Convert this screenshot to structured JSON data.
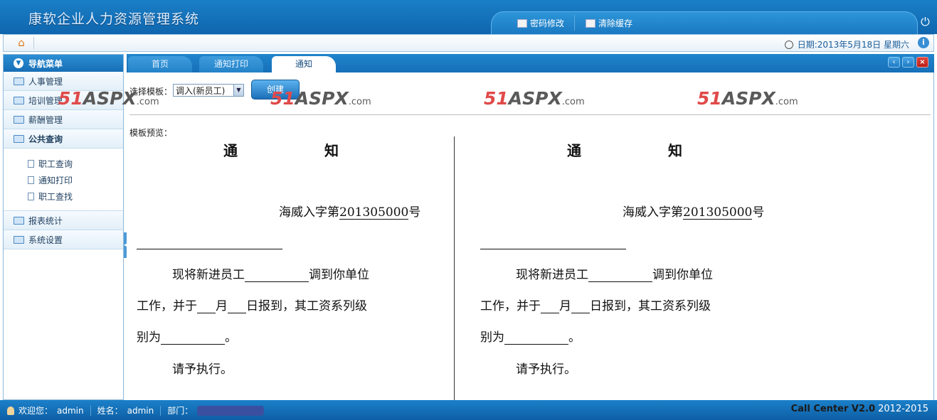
{
  "header": {
    "app_title": "康软企业人力资源管理系统",
    "tools": {
      "password": "密码修改",
      "clear_cache": "清除缓存"
    }
  },
  "subbar": {
    "date_text": "日期:2013年5月18日 星期六"
  },
  "sidebar": {
    "head": "导航菜单",
    "items": [
      {
        "label": "人事管理"
      },
      {
        "label": "培训管理"
      },
      {
        "label": "薪酬管理"
      },
      {
        "label": "公共查询"
      },
      {
        "label": "报表统计"
      },
      {
        "label": "系统设置"
      }
    ],
    "sub_items": [
      {
        "label": "职工查询"
      },
      {
        "label": "通知打印"
      },
      {
        "label": "职工查找"
      }
    ]
  },
  "tabs": [
    {
      "label": "首页"
    },
    {
      "label": "通知打印"
    },
    {
      "label": "通知"
    }
  ],
  "toolbar": {
    "template_label": "选择模板：",
    "template_selected": "调入(新员工)",
    "create_label": "创建"
  },
  "watermark": {
    "num": "51",
    "aspx": "ASPX",
    "dotcom": ".com"
  },
  "preview": {
    "label": "模板预览：",
    "title_1": "通",
    "title_2": "知",
    "doc_prefix": "海威入字第",
    "doc_number": "201305000",
    "doc_suffix": "号",
    "line1_a": "现将新进员工",
    "line1_b": "调到你单位",
    "line2_a": "工作，并于",
    "line2_b": "月",
    "line2_c": "日报到，其工资系列级",
    "line3_a": "别为",
    "line3_b": "。",
    "line4": "请予执行。"
  },
  "footer": {
    "welcome_label": "欢迎您：",
    "welcome_user": "admin",
    "name_label": "姓名：",
    "name_value": "admin",
    "dept_label": "部门：",
    "version": "Call Center V2.0",
    "years": "2012-2015"
  }
}
